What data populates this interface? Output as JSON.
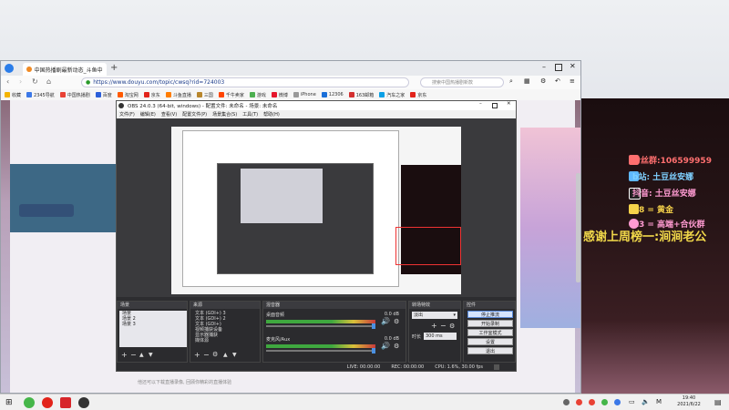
{
  "browser": {
    "tab_title": "中国热播剧最新动态_斗鱼中...",
    "url": "https://www.douyu.com/topic/cwsq?rid=724003",
    "search_placeholder": "搜索中国热播剧新款",
    "bookmarks": [
      "收藏",
      "2345导航",
      "中国热播剧",
      "百度",
      "淘宝网",
      "京东",
      "斗鱼直播",
      "三国",
      "千牛卖家",
      "游戏",
      "微博",
      "iPhone",
      "12306",
      "163邮箱",
      "汽车之家",
      "京东"
    ],
    "page_footer": "他还可以下载直播录像, 回顾你精彩的直播体验"
  },
  "obs": {
    "title": "OBS 24.0.3 (64-bit, windows) - 配置文件: 未命名 - 场景: 未命名",
    "menu": [
      "文件(F)",
      "编辑(E)",
      "查看(V)",
      "配置文件(P)",
      "场景集合(S)",
      "工具(T)",
      "帮助(H)"
    ],
    "scenes_header": "场景",
    "scenes": [
      "场景",
      "场景 2",
      "场景 3"
    ],
    "sources_header": "来源",
    "sources": [
      "文本 (GDI+) 3",
      "文本 (GDI+) 2",
      "文本 (GDI+)",
      "视频捕获设备",
      "显示器捕获",
      "媒体源"
    ],
    "mixer_header": "混音器",
    "mixer": [
      {
        "name": "桌面音频",
        "db": "0.0 dB",
        "level": 0.75
      },
      {
        "name": "麦克风/Aux",
        "db": "0.0 dB",
        "level": 0.6
      }
    ],
    "transitions_header": "转场特效",
    "transition_type": "淡出",
    "duration_label": "时长",
    "duration_value": "300 ms",
    "controls_header": "控件",
    "controls": [
      "停止推流",
      "开始录制",
      "工作室模式",
      "设置",
      "退出"
    ],
    "status": {
      "live": "LIVE: 00:00:00",
      "rec": "REC: 00:00:00",
      "cpu": "CPU: 1.6%, 30.00 fps"
    }
  },
  "stream_panel": {
    "lines": [
      {
        "text": "粉丝群:106599959",
        "color": "#ff6f6f",
        "icon": "fan-group-icon"
      },
      {
        "text": "b站: 土豆丝安娜",
        "color": "#7fd0ff",
        "icon": "bilibili-icon"
      },
      {
        "text": "抖音: 土豆丝安娜",
        "color": "#ff9bd2",
        "icon": "douyin-icon"
      },
      {
        "text": "X8 = 黄金",
        "color": "#f6d24a",
        "icon": "gold-icon"
      },
      {
        "text": "X3 = 高端+合伙群",
        "color": "#ff9bd2",
        "icon": "heart-icon"
      }
    ],
    "thanks": "感谢上周榜一:涧涧老公"
  },
  "taskbar": {
    "time": "19:40",
    "date": "2021/6/22"
  },
  "colors": {
    "obs_bg": "#2d2d30",
    "accent_blue": "#1a73e8",
    "thanks_yellow": "#f2d94a"
  }
}
